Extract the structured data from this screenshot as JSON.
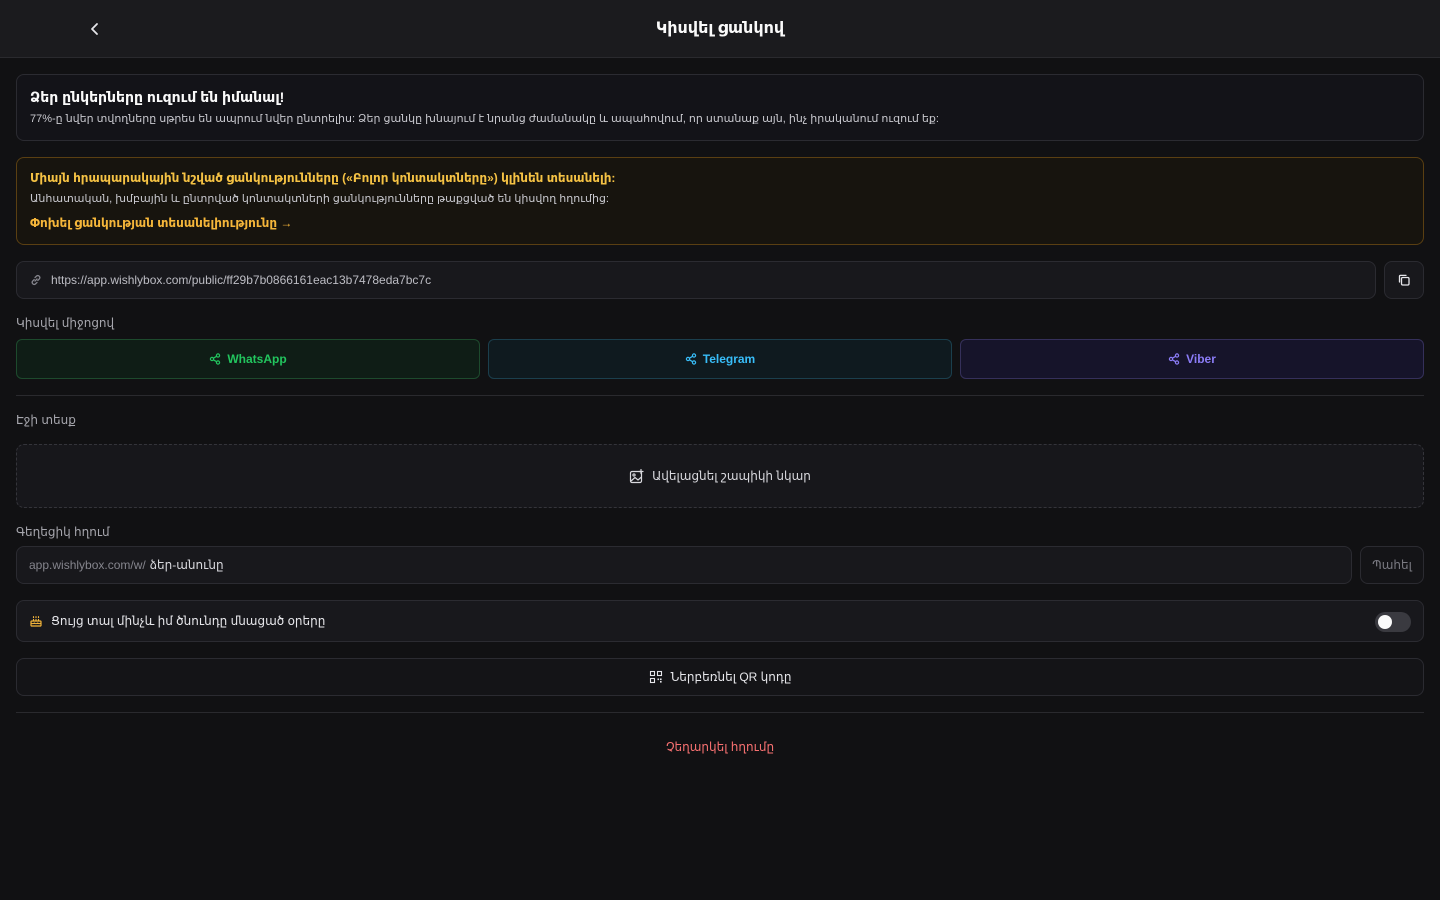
{
  "header": {
    "title": "Կիսվել ցանկով",
    "back_icon": "chevron-left-icon"
  },
  "info_card": {
    "heading": "Ձեր ընկերները ուզում են իմանալ!",
    "text": "77%-ը նվեր տվողները սթրես են ապրում նվեր ընտրելիս: Ձեր ցանկը խնայում է նրանց ժամանակը և ապահովում, որ ստանաք այն, ինչ իրականում ուզում եք:"
  },
  "visibility_warning": {
    "heading": "Միայն հրապարակային նշված ցանկությունները («Բոլոր կոնտակտները») կլինեն տեսանելի:",
    "text": "Անհատական, խմբային և ընտրված կոնտակտների ցանկությունները թաքցված են կիսվող հղումից:",
    "link_label": "Փոխել ցանկության տեսանելիությունը →",
    "color": "#f5c244"
  },
  "share_link": {
    "url": "https://app.wishlybox.com/public/ff29b7b0866161eac13b7478eda7bc7c",
    "link_icon": "link-icon",
    "copy_icon": "copy-icon"
  },
  "share_via": {
    "label": "Կիսվել միջոցով",
    "buttons": [
      {
        "label": "WhatsApp",
        "icon": "share-icon",
        "color": "#22c55e"
      },
      {
        "label": "Telegram",
        "icon": "share-icon",
        "color": "#38bdf8"
      },
      {
        "label": "Viber",
        "icon": "share-icon",
        "color": "#8b7cf6"
      }
    ]
  },
  "page_appearance": {
    "label": "Էջի տեսք",
    "upload_label": "Ավելացնել շապիկի նկար",
    "upload_icon": "image-plus-icon"
  },
  "custom_link": {
    "label": "Գեղեցիկ հղում",
    "prefix": "app.wishlybox.com/w/",
    "placeholder": "ձեր-անունը",
    "save_label": "Պահել"
  },
  "birthday": {
    "label": "Ցույց տալ մինչև իմ ծնունդը մնացած օրերը",
    "icon": "cake-icon",
    "enabled": false
  },
  "qr": {
    "label": "Ներբեռնել QR կոդը",
    "icon": "qr-code-icon"
  },
  "disable_link": {
    "label": "Չեղարկել հղումը",
    "color": "#f87171"
  }
}
